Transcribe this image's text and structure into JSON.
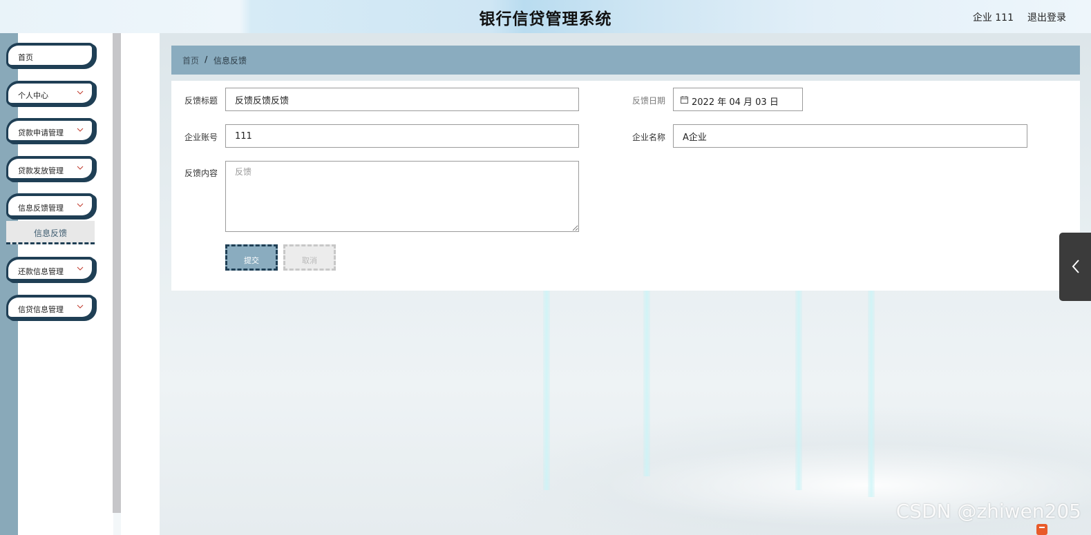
{
  "header": {
    "title": "银行信贷管理系统",
    "user": "企业 111",
    "logout": "退出登录"
  },
  "sidebar": {
    "items": [
      {
        "label": "首页",
        "has_chevron": false
      },
      {
        "label": "个人中心",
        "has_chevron": true
      },
      {
        "label": "贷款申请管理",
        "has_chevron": true
      },
      {
        "label": "贷款发放管理",
        "has_chevron": true
      },
      {
        "label": "信息反馈管理",
        "has_chevron": true
      },
      {
        "label": "还款信息管理",
        "has_chevron": true
      },
      {
        "label": "信贷信息管理",
        "has_chevron": true
      }
    ],
    "active_sub": "信息反馈"
  },
  "breadcrumb": {
    "home": "首页",
    "separator": "/",
    "current": "信息反馈"
  },
  "form": {
    "title_label": "反馈标题",
    "title_value": "反馈反馈反馈",
    "date_label": "反馈日期",
    "date_value": "2022 年 04 月 03 日",
    "account_label": "企业账号",
    "account_value": "111",
    "name_label": "企业名称",
    "name_value": "A企业",
    "content_label": "反馈内容",
    "content_placeholder": "反馈",
    "submit": "提交",
    "cancel": "取消"
  },
  "watermark": "CSDN @zhiwen205",
  "colors": {
    "accent": "#8aacbf",
    "dark": "#1f3f55",
    "stripe": "#89a9b9"
  }
}
